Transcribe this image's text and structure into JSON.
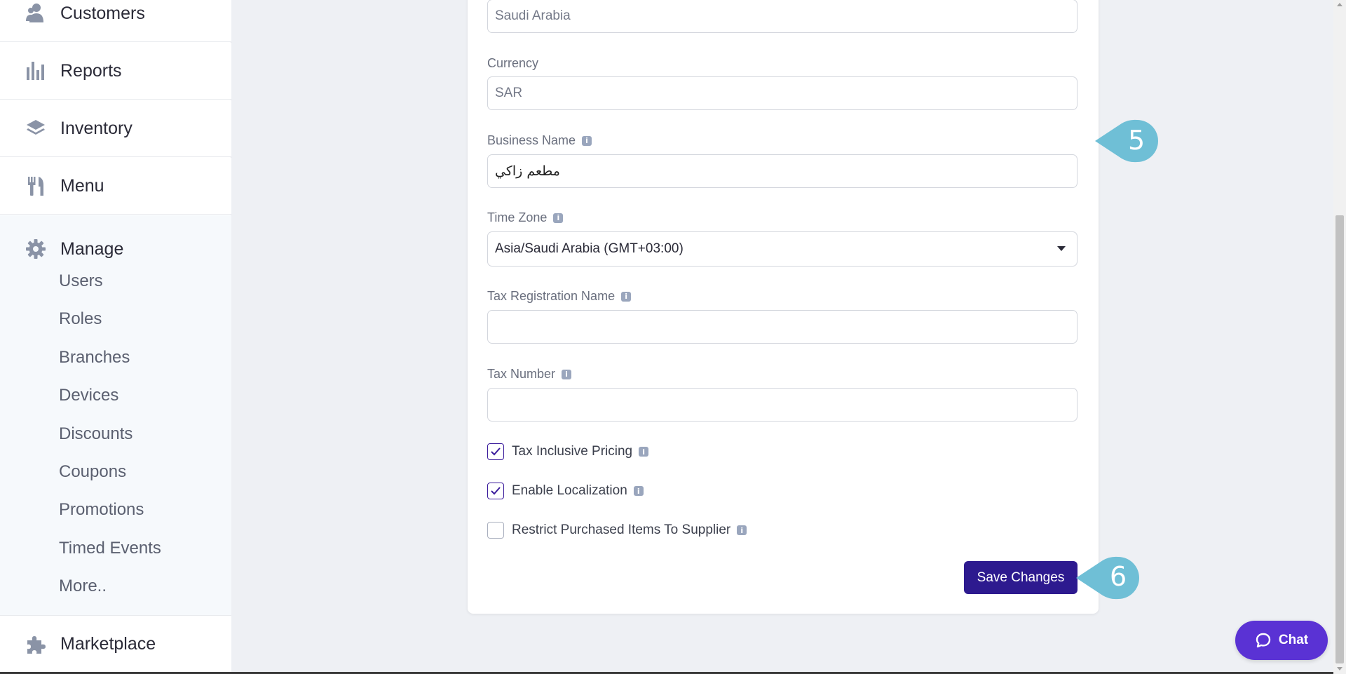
{
  "sidebar": {
    "items": [
      {
        "label": "Customers",
        "icon": "customers-icon"
      },
      {
        "label": "Reports",
        "icon": "reports-icon"
      },
      {
        "label": "Inventory",
        "icon": "inventory-icon"
      },
      {
        "label": "Menu",
        "icon": "menu-icon"
      }
    ],
    "manage": {
      "label": "Manage",
      "icon": "gear-icon",
      "subitems": [
        "Users",
        "Roles",
        "Branches",
        "Devices",
        "Discounts",
        "Coupons",
        "Promotions",
        "Timed Events",
        "More.."
      ]
    },
    "marketplace": {
      "label": "Marketplace",
      "icon": "puzzle-icon"
    }
  },
  "form": {
    "country_value": "Saudi Arabia",
    "currency": {
      "label": "Currency",
      "value": "SAR"
    },
    "business_name": {
      "label": "Business Name",
      "value": "مطعم زاكي"
    },
    "time_zone": {
      "label": "Time Zone",
      "value": "Asia/Saudi Arabia (GMT+03:00)"
    },
    "tax_registration_name": {
      "label": "Tax Registration Name",
      "value": ""
    },
    "tax_number": {
      "label": "Tax Number",
      "value": ""
    },
    "checkboxes": [
      {
        "label": "Tax Inclusive Pricing",
        "checked": true
      },
      {
        "label": "Enable Localization",
        "checked": true
      },
      {
        "label": "Restrict Purchased Items To Supplier",
        "checked": false
      }
    ],
    "save_label": "Save Changes"
  },
  "callouts": {
    "step5": "5",
    "step6": "6"
  },
  "chat": {
    "label": "Chat"
  },
  "colors": {
    "primary": "#2d1a8f",
    "chat": "#5a32d4",
    "callout": "#6fbfd6",
    "icon": "#8a93a6"
  }
}
